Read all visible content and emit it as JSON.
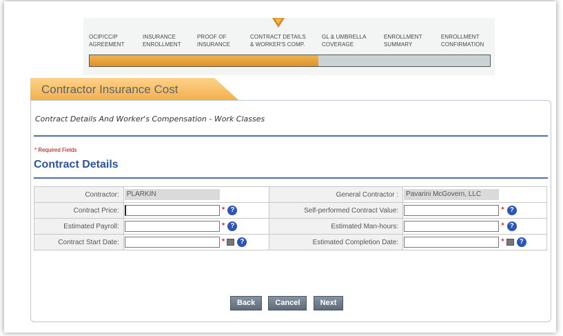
{
  "steps": [
    {
      "line1": "OCIP/CCIP",
      "line2": "AGREEMENT"
    },
    {
      "line1": "INSURANCE",
      "line2": "ENROLLMENT"
    },
    {
      "line1": "PROOF OF",
      "line2": "INSURANCE"
    },
    {
      "line1": "CONTRACT DETAILS",
      "line2": "& WORKER'S COMP."
    },
    {
      "line1": "GL & UMBRELLA",
      "line2": "COVERAGE"
    },
    {
      "line1": "ENROLLMENT",
      "line2": "SUMMARY"
    },
    {
      "line1": "ENROLLMENT",
      "line2": "CONFIRMATION"
    }
  ],
  "progress": {
    "current_step": 4,
    "total_steps": 7
  },
  "page_title": "Contractor Insurance Cost",
  "subtitle": "Contract Details And Worker's Compensation - Work Classes",
  "required_note": "* Required Fields",
  "section_title": "Contract Details",
  "form": {
    "contractor_label": "Contractor:",
    "contractor_value": "PLARKIN",
    "general_contractor_label": "General Contractor :",
    "general_contractor_value": "Pavarini McGovern, LLC",
    "contract_price_label": "Contract Price:",
    "self_performed_label": "Self-performed Contract Value:",
    "estimated_payroll_label": "Estimated Payroll:",
    "estimated_manhours_label": "Estimated Man-hours:",
    "start_date_label": "Contract Start Date:",
    "completion_date_label": "Estimated Completion Date:"
  },
  "required_mark": "*",
  "help_glyph": "?",
  "buttons": {
    "back": "Back",
    "cancel": "Cancel",
    "next": "Next"
  },
  "colors": {
    "accent_orange": "#f4b04d",
    "link_blue": "#2a5599",
    "required_red": "#d00000"
  }
}
